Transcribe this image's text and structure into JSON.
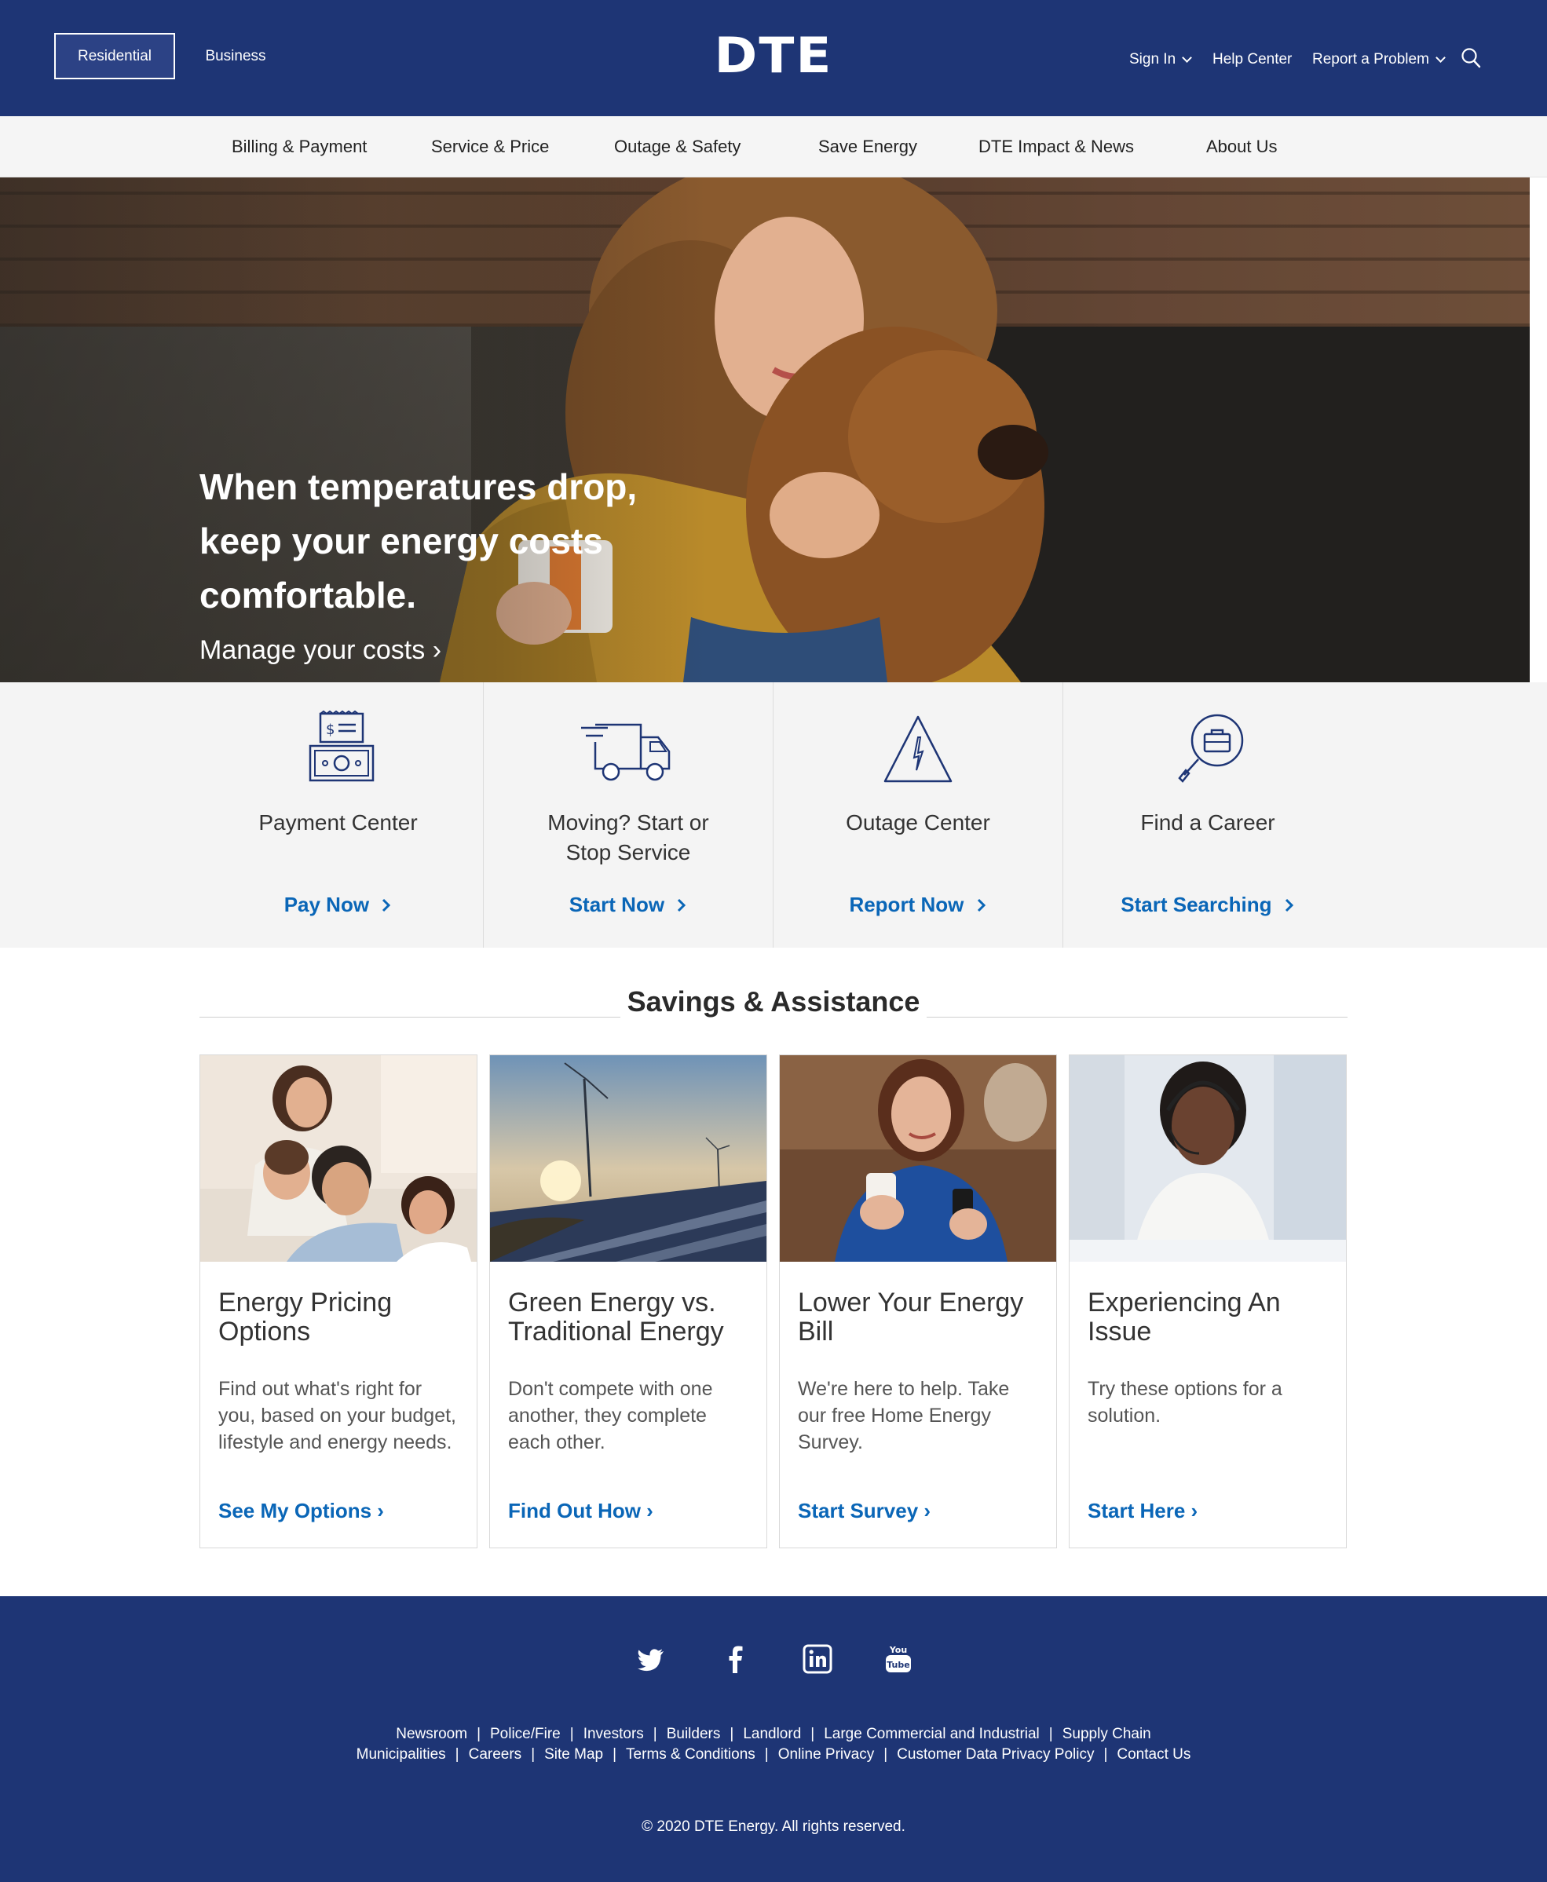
{
  "header": {
    "segments": [
      "Residential",
      "Business"
    ],
    "logo_text": "DTE",
    "utility": {
      "sign_in": "Sign In",
      "help_center": "Help Center",
      "report_problem": "Report a Problem"
    }
  },
  "nav": {
    "items": [
      "Billing & Payment",
      "Service & Price",
      "Outage & Safety",
      "Save Energy",
      "DTE Impact & News",
      "About Us"
    ]
  },
  "hero": {
    "headline": "When temperatures drop, keep your energy costs comfortable.",
    "link": "Manage your costs ›"
  },
  "quick_links": [
    {
      "title": "Payment Center",
      "link": "Pay Now",
      "icon": "bill-payment-icon"
    },
    {
      "title": "Moving? Start or Stop Service",
      "link": "Start Now",
      "icon": "moving-truck-icon"
    },
    {
      "title": "Outage Center",
      "link": "Report Now",
      "icon": "warning-icon"
    },
    {
      "title": "Find a Career",
      "link": "Start Searching",
      "icon": "career-search-icon"
    }
  ],
  "savings": {
    "title": "Savings & Assistance",
    "cards": [
      {
        "title": "Energy Pricing Options",
        "text": "Find out what's right for you, based on your budget, lifestyle and energy needs.",
        "link": "See My Options ›"
      },
      {
        "title": "Green Energy vs. Traditional Energy",
        "text": "Don't compete with one another, they complete each other.",
        "link": "Find Out How ›"
      },
      {
        "title": "Lower Your Energy Bill",
        "text": "We're here to help. Take our free Home Energy Survey.",
        "link": "Start Survey ›"
      },
      {
        "title": "Experiencing An Issue",
        "text": "Try these options for a solution.",
        "link": "Start Here ›"
      }
    ]
  },
  "footer": {
    "social": [
      "twitter-icon",
      "facebook-icon",
      "linkedin-icon",
      "youtube-icon"
    ],
    "row1": [
      "Newsroom",
      "Police/Fire",
      "Investors",
      "Builders",
      "Landlord",
      "Large Commercial and Industrial",
      "Supply Chain"
    ],
    "row2": [
      "Municipalities",
      "Careers",
      "Site Map",
      "Terms & Conditions",
      "Online Privacy",
      "Customer Data Privacy Policy",
      "Contact Us"
    ],
    "copyright": "© 2020 DTE Energy. All rights reserved."
  },
  "colors": {
    "brand_navy": "#1e3575",
    "link_blue": "#0a66b7",
    "nav_bg": "#f5f5f5"
  }
}
